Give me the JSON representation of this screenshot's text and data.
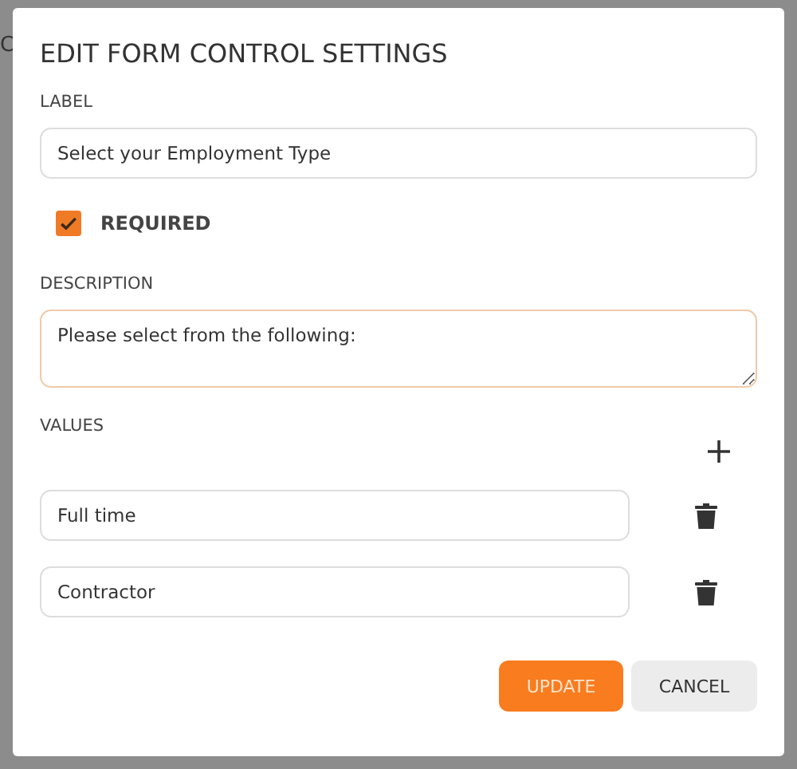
{
  "background_text": "C",
  "dialog": {
    "title": "EDIT FORM CONTROL SETTINGS",
    "label": {
      "caption": "LABEL",
      "value": "Select your Employment Type"
    },
    "required": {
      "caption": "REQUIRED",
      "checked": true
    },
    "description": {
      "caption": "DESCRIPTION",
      "value": "Please select from the following:",
      "focused": true
    },
    "values": {
      "caption": "VALUES",
      "items": [
        {
          "value": "Full time"
        },
        {
          "value": "Contractor"
        }
      ]
    },
    "buttons": [
      {
        "label": "UPDATE",
        "kind": "primary"
      },
      {
        "label": "CANCEL",
        "kind": "secondary"
      }
    ]
  }
}
